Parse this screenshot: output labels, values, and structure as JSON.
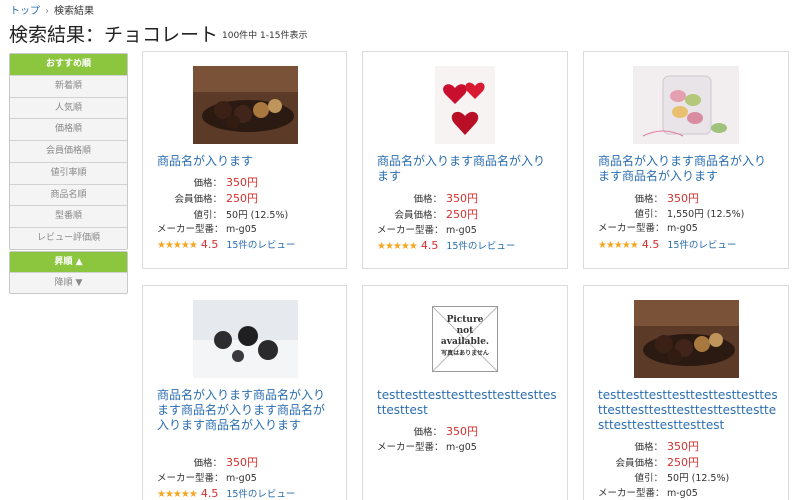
{
  "breadcrumb": {
    "home": "トップ",
    "separator": "›",
    "current": "検索結果"
  },
  "page_title": "検索結果：チョコレート",
  "result_count": "100件中 1-15件表示",
  "sort_options": [
    "おすすめ順",
    "新着順",
    "人気順",
    "価格順",
    "会員価格順",
    "値引率順",
    "商品名順",
    "型番順",
    "レビュー評価順"
  ],
  "order_options": [
    "昇順 ▲",
    "降順 ▼"
  ],
  "labels": {
    "price": "価格：",
    "member_price": "会員価格：",
    "discount": "値引：",
    "maker": "メーカー型番："
  },
  "products": [
    {
      "name": "商品名が入ります",
      "price": "350円",
      "member_price": "250円",
      "discount": "50円 (12.5%)",
      "maker": "m-g05",
      "stars": "★★★★★",
      "rating": "4.5",
      "reviews": "15件のレビュー",
      "image": "chocolate-truffles-photo"
    },
    {
      "name": "商品名が入ります商品名が入ります",
      "price": "350円",
      "member_price": "250円",
      "maker": "m-g05",
      "stars": "★★★★★",
      "rating": "4.5",
      "reviews": "15件のレビュー",
      "image": "red-heart-chocolates-photo"
    },
    {
      "name": "商品名が入ります商品名が入ります商品名が入ります",
      "price": "350円",
      "discount": "1,550円 (12.5%)",
      "maker": "m-g05",
      "stars": "★★★★★",
      "rating": "4.5",
      "reviews": "15件のレビュー",
      "image": "macarons-jar-photo"
    },
    {
      "name": "商品名が入ります商品名が入ります商品名が入ります商品名が入ります商品名が入ります",
      "price": "350円",
      "maker": "m-g05",
      "stars": "★★★★★",
      "rating": "4.5",
      "reviews": "15件のレビュー",
      "image": "chocolates-on-sugar-photo"
    },
    {
      "name": "testtesttesttesttesttesttesttesttesttest",
      "price": "350円",
      "maker": "m-g05",
      "image": "no-image-placeholder",
      "placeholder": [
        "Picture",
        "not",
        "available.",
        "写真はありません"
      ]
    },
    {
      "name": "testtesttesttesttesttesttesttesttesttesttesttesttesttesttesttesttesttesttesttesttest",
      "price": "350円",
      "member_price": "250円",
      "discount": "50円 (12.5%)",
      "maker": "m-g05",
      "image": "chocolate-truffles-photo"
    }
  ]
}
